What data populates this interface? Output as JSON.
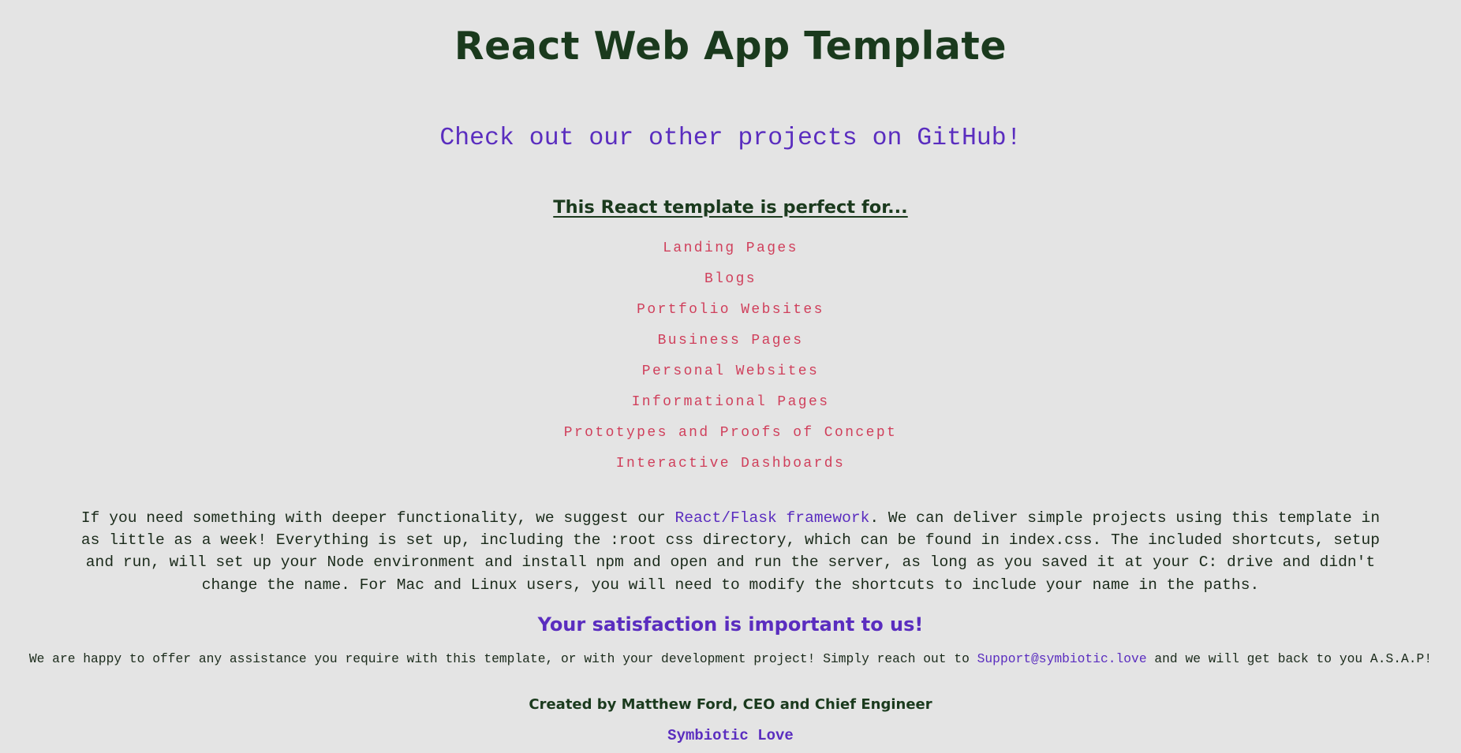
{
  "header": {
    "title": "React Web App Template"
  },
  "github_link": "Check out our other projects on GitHub!",
  "uses": {
    "heading": "This React template is perfect for...",
    "items": [
      "Landing Pages",
      "Blogs",
      "Portfolio Websites",
      "Business Pages",
      "Personal Websites",
      "Informational Pages",
      "Prototypes and Proofs of Concept",
      "Interactive Dashboards"
    ]
  },
  "description": {
    "before_link": "If you need something with deeper functionality, we suggest our ",
    "link": "React/Flask framework",
    "after_link": ". We can deliver simple projects using this template in as little as a week! Everything is set up, including the :root css directory, which can be found in index.css. The included shortcuts, setup and run, will set up your Node environment and install npm and open and run the server, as long as you saved it at your C: drive and didn't change the name. For Mac and Linux users, you will need to modify the shortcuts to include your name in the paths."
  },
  "satisfaction": {
    "heading": "Your satisfaction is important to us!",
    "before_email": "We are happy to offer any assistance you require with this template, or with your development project! Simply reach out to ",
    "email": "Support@symbiotic.love",
    "after_email": " and we will get back to you A.S.A.P!"
  },
  "footer": {
    "credit": "Created by Matthew Ford, CEO and Chief Engineer",
    "company_link": "Symbiotic Love"
  },
  "colors": {
    "background": "#e4e4e4",
    "heading": "#1a3a1d",
    "link": "#5a2dbf",
    "list": "#d0405c"
  }
}
